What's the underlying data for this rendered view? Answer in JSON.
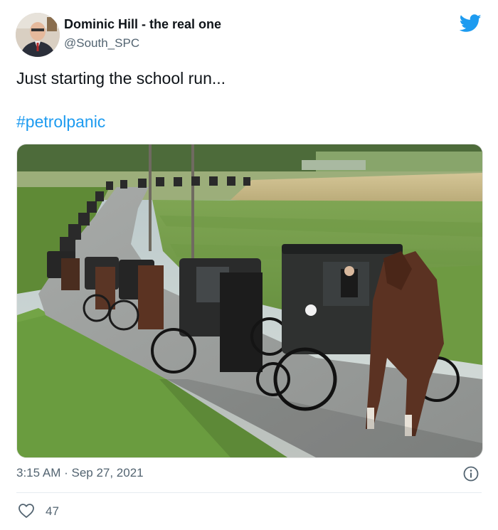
{
  "author": {
    "name": "Dominic Hill - the real one",
    "handle": "@South_SPC"
  },
  "tweet": {
    "text": "Just starting the school run...",
    "hashtag": "#petrolpanic",
    "timestamp": "3:15 AM · Sep 27, 2021",
    "likes": "47"
  },
  "icons": {
    "brand": "twitter-bird-icon",
    "info": "info-icon",
    "like": "heart-icon"
  },
  "colors": {
    "brand_blue": "#1d9bf0",
    "text": "#0f1419",
    "muted": "#536471"
  }
}
